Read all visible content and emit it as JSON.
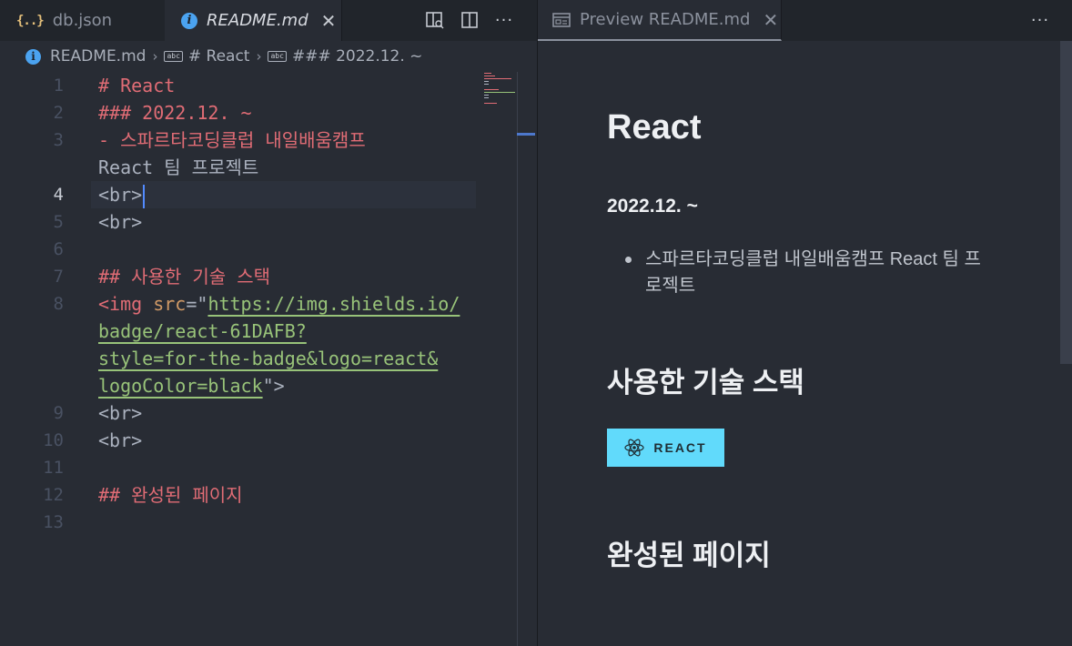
{
  "left_group": {
    "tabs": [
      {
        "icon": "json-icon",
        "icon_text": "{..}",
        "label": "db.json",
        "active": false
      },
      {
        "icon": "info-icon",
        "icon_text": "i",
        "label": "README.md",
        "active": true,
        "close": "✕"
      }
    ],
    "more_glyph": "···"
  },
  "breadcrumb": {
    "items": [
      "README.md",
      "# React",
      "### 2022.12. ~"
    ],
    "symbol_glyph": "abc",
    "separator": "›"
  },
  "editor": {
    "line_numbers": [
      "1",
      "2",
      "3",
      "4",
      "5",
      "6",
      "7",
      "8",
      "9",
      "10",
      "11",
      "12",
      "13"
    ],
    "current_line": "4",
    "lines": {
      "l1": "# React",
      "l2": "### 2022.12. ~",
      "l3a": "- 스파르타코딩클럽 내일배움캠프",
      "l3b": "React 팀 프로젝트",
      "br": "<br>",
      "l7": "## 사용한 기술 스택",
      "l8_tag": "<img",
      "l8_attr": "src",
      "l8_eq": "=\"",
      "l8_url1": "https://img.shields.io/",
      "l8_url2": "badge/react-61DAFB?",
      "l8_url3": "style=for-the-badge&logo=react&",
      "l8_url4": "logoColor=black",
      "l8_close": "\">",
      "l12": "## 완성된 페이지"
    }
  },
  "right_group": {
    "tab": {
      "icon": "preview-icon",
      "label": "Preview README.md",
      "close": "✕"
    },
    "more_glyph": "···"
  },
  "preview": {
    "h1": "React",
    "h3": "2022.12. ~",
    "list_item": "스파르타코딩클럽 내일배움캠프 React 팀 프로젝트",
    "h2_stack": "사용한 기술 스택",
    "badge_label": "REACT",
    "h2_done": "완성된 페이지"
  },
  "colors": {
    "background": "#282c34",
    "tabbar": "#21252b",
    "keyword_red": "#e06c75",
    "string_green": "#98c379",
    "attr_orange": "#d19a66",
    "badge_cyan": "#61dafb",
    "info_blue": "#4ba3f0",
    "caret_blue": "#528bff"
  }
}
